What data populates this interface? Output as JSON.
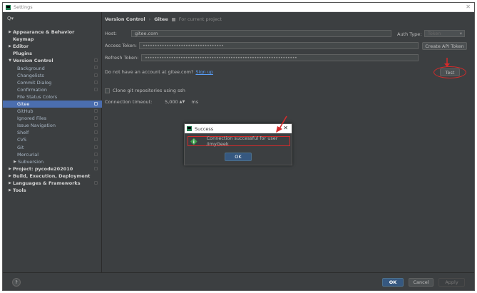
{
  "window": {
    "title": "Settings"
  },
  "search": {
    "icon": "search-icon",
    "text": "Q▾"
  },
  "tree": [
    {
      "label": "Appearance & Behavior",
      "bold": true,
      "arrow": "▶",
      "level": 0,
      "proj": false
    },
    {
      "label": "Keymap",
      "bold": true,
      "arrow": "",
      "level": 0,
      "proj": false
    },
    {
      "label": "Editor",
      "bold": true,
      "arrow": "▶",
      "level": 0,
      "proj": false
    },
    {
      "label": "Plugins",
      "bold": true,
      "arrow": "",
      "level": 0,
      "proj": false
    },
    {
      "label": "Version Control",
      "bold": true,
      "arrow": "▼",
      "level": 0,
      "proj": true
    },
    {
      "label": "Background",
      "level": 1,
      "proj": true
    },
    {
      "label": "Changelists",
      "level": 1,
      "proj": true
    },
    {
      "label": "Commit Dialog",
      "level": 1,
      "proj": true
    },
    {
      "label": "Confirmation",
      "level": 1,
      "proj": true
    },
    {
      "label": "File Status Colors",
      "level": 1,
      "proj": false
    },
    {
      "label": "Gitee",
      "level": 1,
      "proj": true,
      "selected": true
    },
    {
      "label": "GitHub",
      "level": 1,
      "proj": true
    },
    {
      "label": "Ignored Files",
      "level": 1,
      "proj": true
    },
    {
      "label": "Issue Navigation",
      "level": 1,
      "proj": true
    },
    {
      "label": "Shelf",
      "level": 1,
      "proj": true
    },
    {
      "label": "CVS",
      "level": 1,
      "proj": true
    },
    {
      "label": "Git",
      "level": 1,
      "proj": true
    },
    {
      "label": "Mercurial",
      "level": 1,
      "proj": true
    },
    {
      "label": "Subversion",
      "level": 1,
      "proj": true,
      "arrow": "▶"
    },
    {
      "label": "Project: pycode202010",
      "bold": true,
      "arrow": "▶",
      "level": 0,
      "proj": true
    },
    {
      "label": "Build, Execution, Deployment",
      "bold": true,
      "arrow": "▶",
      "level": 0,
      "proj": false
    },
    {
      "label": "Languages & Frameworks",
      "bold": true,
      "arrow": "▶",
      "level": 0,
      "proj": true
    },
    {
      "label": "Tools",
      "bold": true,
      "arrow": "▶",
      "level": 0,
      "proj": false
    }
  ],
  "breadcrumb": {
    "section": "Version Control",
    "sep": "›",
    "page": "Gitee",
    "scope": "For current project"
  },
  "form": {
    "host_label": "Host:",
    "host_value": "gitee.com",
    "auth_type_label": "Auth Type:",
    "auth_type_value": "Token",
    "access_token_label": "Access Token:",
    "access_token_value": "••••••••••••••••••••••••••••••••••",
    "create_api_token": "Create API Token",
    "refresh_token_label": "Refresh Token:",
    "refresh_token_value": "••••••••••••••••••••••••••••••••••••••••••••••••••••••••••••••••",
    "no_account_text": "Do not have an account at gitee.com?",
    "sign_up": "Sign up",
    "test_button": "Test",
    "clone_ssh": "Clone git repositories using ssh",
    "timeout_label": "Connection timeout:",
    "timeout_value": "5,000",
    "timeout_unit": "ms"
  },
  "dialog": {
    "title": "Success",
    "message": "Connection successful for user /imyGeek",
    "ok": "OK",
    "close": "✕"
  },
  "bottom": {
    "help": "?",
    "ok": "OK",
    "cancel": "Cancel",
    "apply": "Apply"
  },
  "colors": {
    "accent": "#4b6eaf",
    "annotation": "#d42b2b",
    "ok_primary": "#365880"
  }
}
